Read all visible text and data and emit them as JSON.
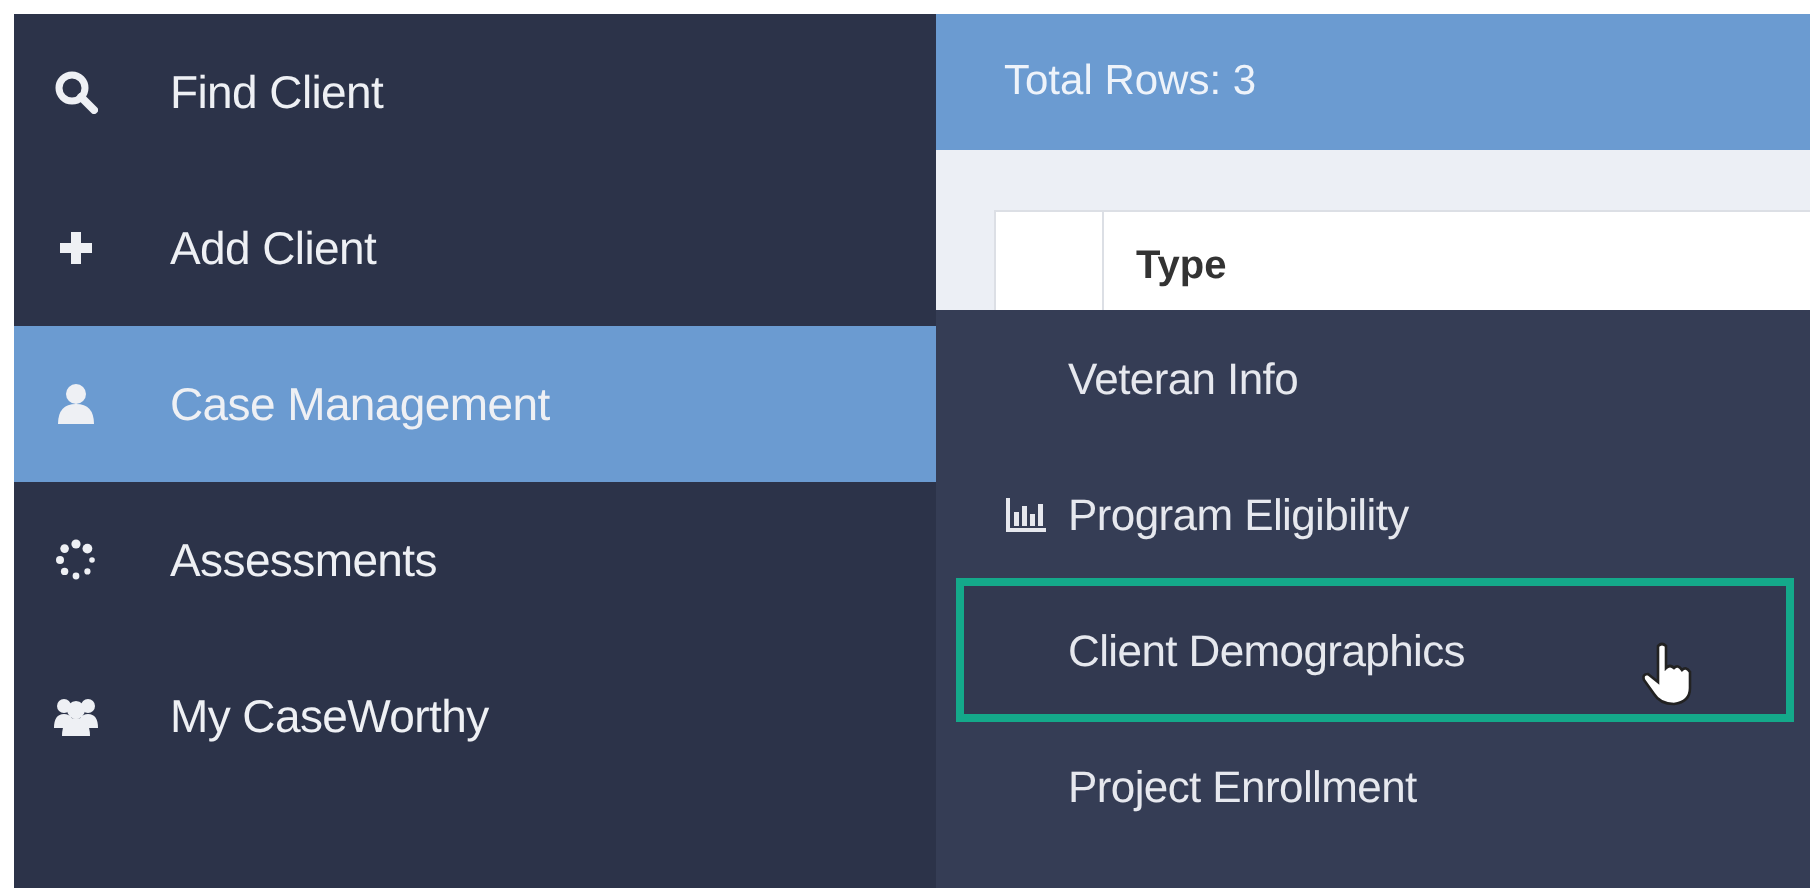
{
  "sidebar": {
    "items": [
      {
        "label": "Find Client",
        "selected": false
      },
      {
        "label": "Add Client",
        "selected": false
      },
      {
        "label": "Case Management",
        "selected": true
      },
      {
        "label": "Assessments",
        "selected": false
      },
      {
        "label": "My CaseWorthy",
        "selected": false
      }
    ]
  },
  "header": {
    "title": "Total Rows: 3"
  },
  "table": {
    "columns": [
      "",
      "Type"
    ]
  },
  "submenu": {
    "items": [
      {
        "label": "Veteran Info",
        "hovered": false,
        "annotated": false
      },
      {
        "label": "Program Eligibility",
        "hovered": false,
        "annotated": false
      },
      {
        "label": "Client Demographics",
        "hovered": true,
        "annotated": true
      },
      {
        "label": "Project Enrollment",
        "hovered": false,
        "annotated": false
      }
    ]
  }
}
